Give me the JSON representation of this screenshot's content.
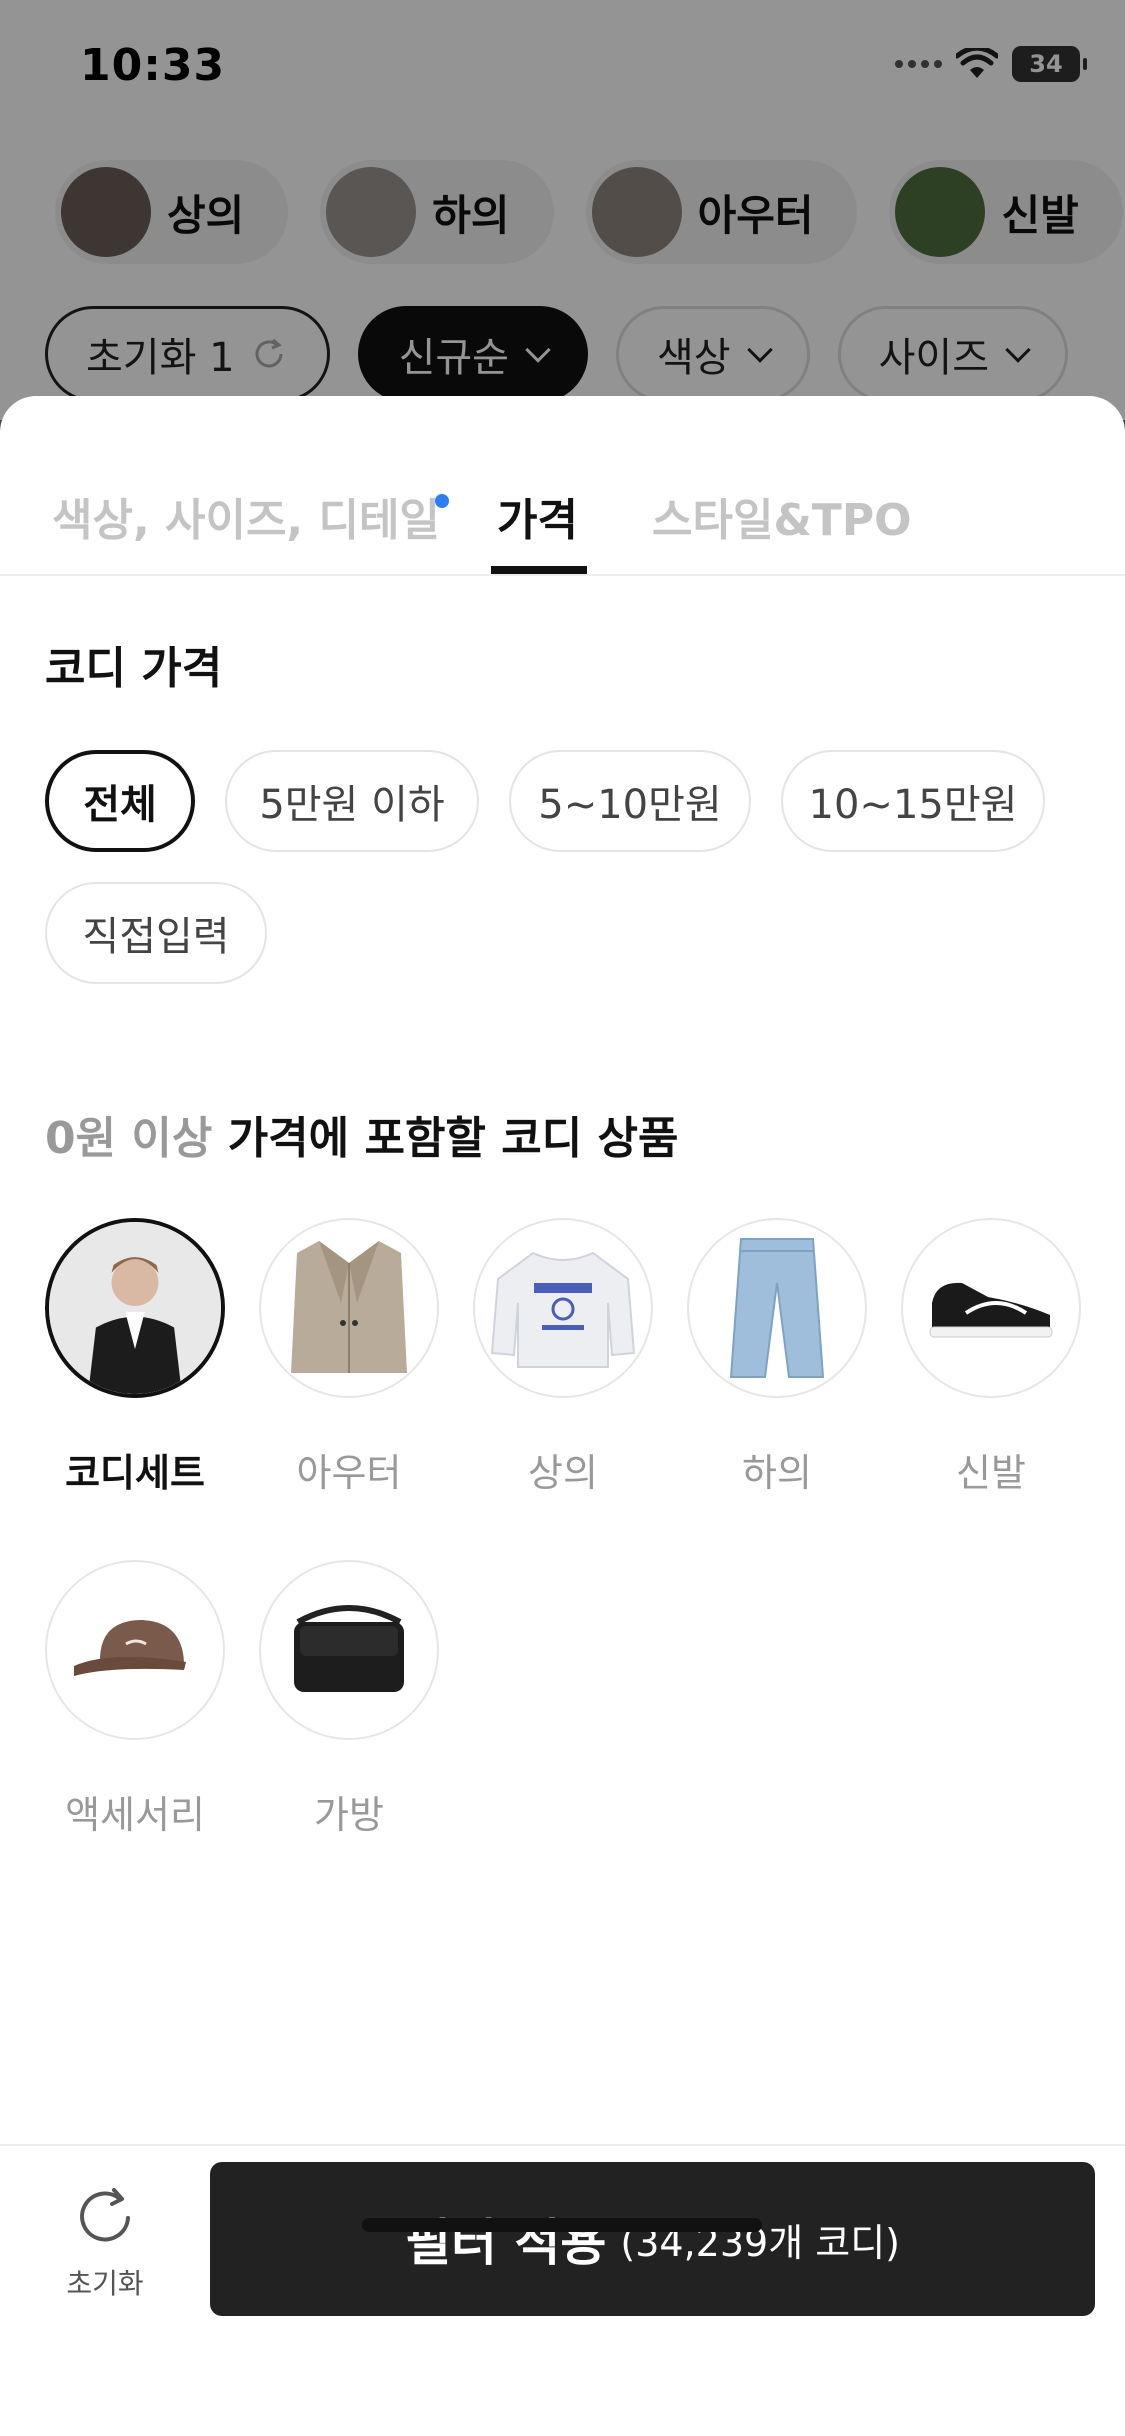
{
  "status_bar": {
    "time": "10:33",
    "battery": "34"
  },
  "categories": [
    {
      "label": "상의"
    },
    {
      "label": "하의"
    },
    {
      "label": "아우터"
    },
    {
      "label": "신발"
    }
  ],
  "filters": {
    "reset": "초기화 1",
    "sort": "신규순",
    "color": "색상",
    "size": "사이즈"
  },
  "sheet": {
    "tabs": [
      {
        "label": "색상, 사이즈, 디테일"
      },
      {
        "label": "가격"
      },
      {
        "label": "스타일&TPO"
      }
    ],
    "price_title": "코디 가격",
    "price_options": [
      {
        "label": "전체",
        "selected": true
      },
      {
        "label": "5만원 이하"
      },
      {
        "label": "5~10만원"
      },
      {
        "label": "10~15만원"
      },
      {
        "label": "직접입력"
      }
    ],
    "include_title_muted": "0원 이상",
    "include_title": "가격에 포함할 코디 상품",
    "items": [
      {
        "label": "코디세트",
        "icon": "person-outfit-icon",
        "selected": true
      },
      {
        "label": "아우터",
        "icon": "blazer-icon"
      },
      {
        "label": "상의",
        "icon": "sweatshirt-icon"
      },
      {
        "label": "하의",
        "icon": "jeans-icon"
      },
      {
        "label": "신발",
        "icon": "sneaker-icon"
      },
      {
        "label": "액세서리",
        "icon": "cap-icon"
      },
      {
        "label": "가방",
        "icon": "bag-icon"
      }
    ]
  },
  "bottom_bar": {
    "reset_label": "초기화",
    "apply_label": "필터 적용",
    "apply_count": "(34,239개 코디)"
  },
  "colors": {
    "accent_dot": "#2f7ef7",
    "apply_bg": "#222222",
    "dim_overlay": "rgba(0,0,0,0.42)"
  }
}
